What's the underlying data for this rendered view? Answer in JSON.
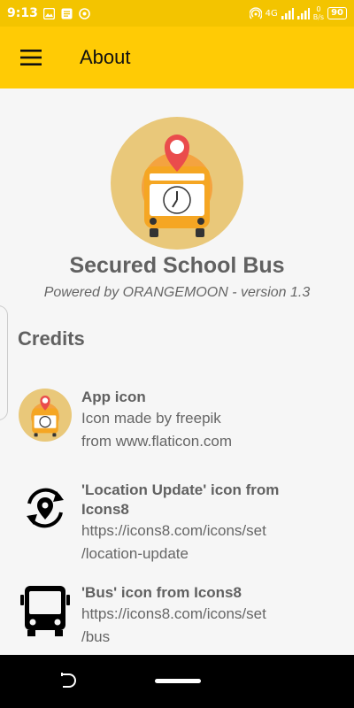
{
  "status_bar": {
    "time": "9:13",
    "network": "4G",
    "speed_value": "0",
    "speed_unit": "B/s",
    "battery": "90"
  },
  "app_bar": {
    "title": "About",
    "menu_icon": "hamburger-menu-icon"
  },
  "about": {
    "app_name": "Secured School Bus",
    "powered_by": "Powered by ORANGEMOON - version 1.3",
    "credits_heading": "Credits"
  },
  "credits": [
    {
      "icon": "school-bus-pin-icon",
      "title": "App icon",
      "line1": "Icon made by freepik",
      "line2": "from www.flaticon.com"
    },
    {
      "icon": "location-update-icon",
      "title_line1": "'Location Update' icon from",
      "title_line2": "Icons8",
      "line1": "https://icons8.com/icons/set",
      "line2": "/location-update"
    },
    {
      "icon": "bus-icon",
      "title": "'Bus' icon from Icons8",
      "line1": "https://icons8.com/icons/set",
      "line2": "/bus"
    }
  ],
  "colors": {
    "status_bar": "#f3c400",
    "app_bar": "#ffcb05",
    "background": "#f6f6f6",
    "text_muted": "#666666"
  }
}
